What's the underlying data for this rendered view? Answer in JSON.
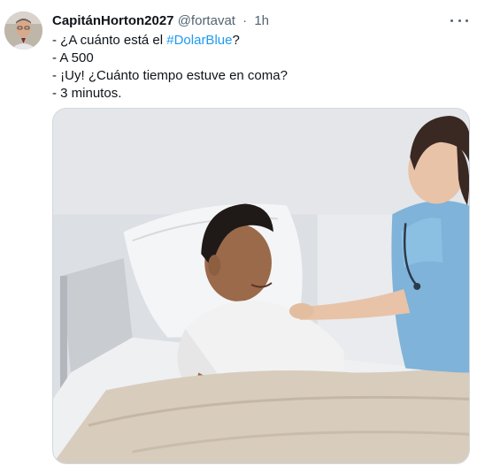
{
  "tweet": {
    "author_name": "CapitánHorton2027",
    "author_handle": "@fortavat",
    "separator": "·",
    "time": "1h",
    "more_icon": "more-horizontal-icon",
    "lines": {
      "line1_prefix": "- ¿A cuánto está el ",
      "line1_hashtag": "#DolarBlue",
      "line1_suffix": "?",
      "line2": "- A 500",
      "line3": "- ¡Uy! ¿Cuánto tiempo estuve en coma?",
      "line4": "- 3 minutos."
    },
    "colors": {
      "hashtag": "#1d9bf0",
      "secondary_text": "#536471",
      "primary_text": "#0f1419"
    }
  }
}
